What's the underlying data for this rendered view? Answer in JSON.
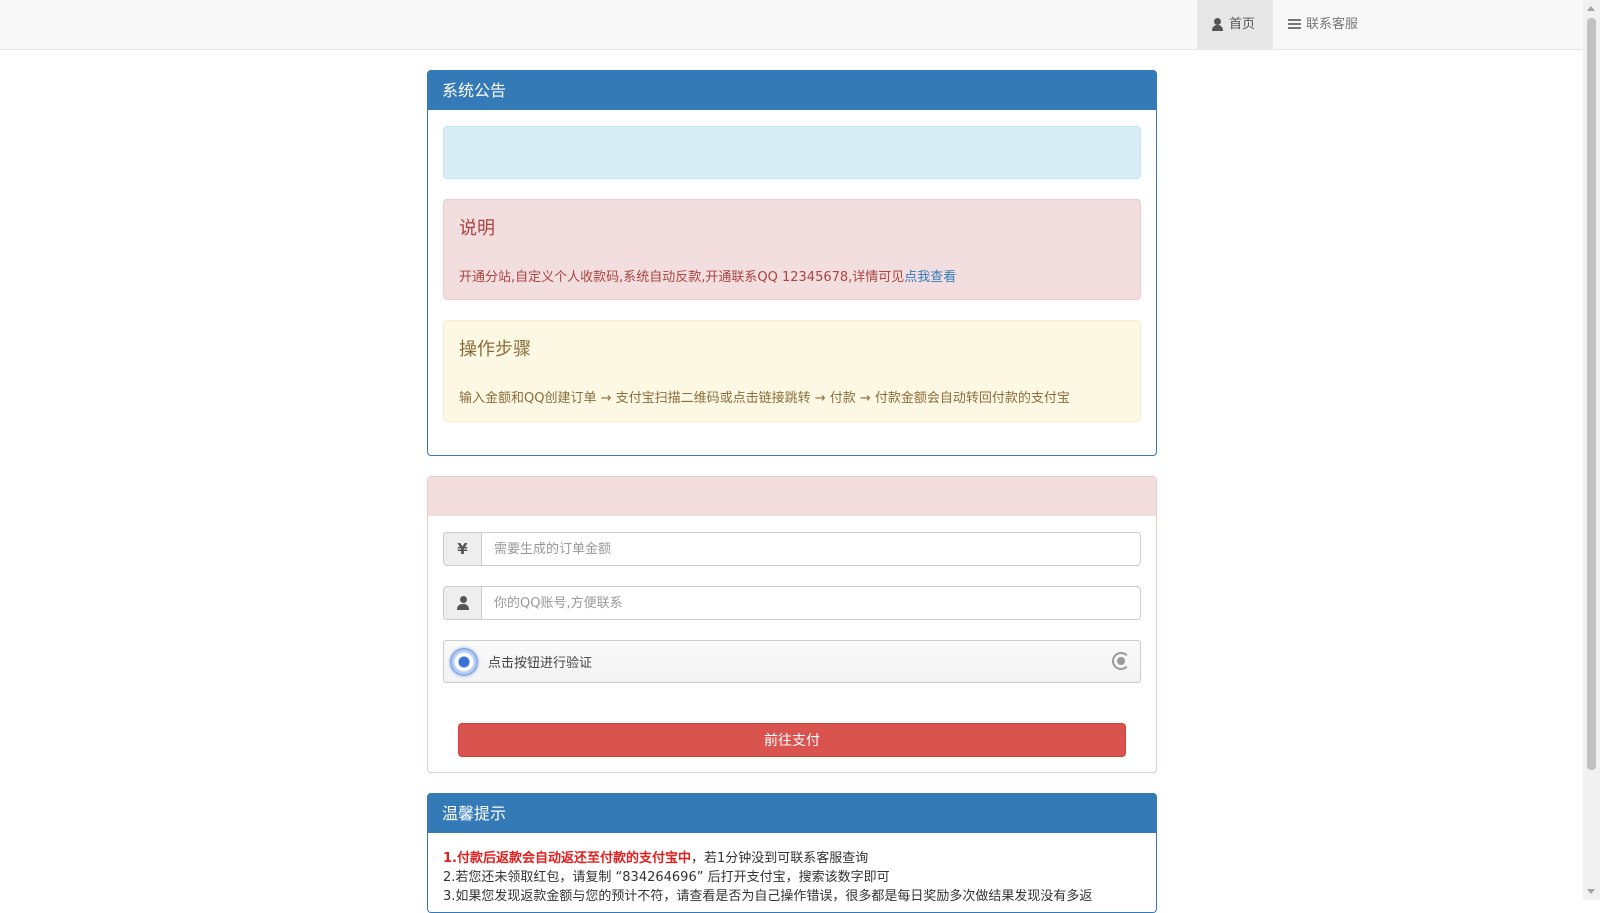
{
  "nav": {
    "home_label": "首页",
    "support_label": "联系客服"
  },
  "announcement": {
    "title": "系统公告",
    "info_text": "",
    "description": {
      "heading": "说明",
      "text": "开通分站,自定义个人收款码,系统自动反款,开通联系QQ 12345678,详情可见",
      "link_label": "点我查看"
    },
    "steps": {
      "heading": "操作步骤",
      "text": "输入金额和QQ创建订单 → 支付宝扫描二维码或点击链接跳转 → 付款 → 付款金额会自动转回付款的支付宝"
    }
  },
  "order_form": {
    "heading_text": "",
    "amount": {
      "icon": "yen-icon",
      "icon_glyph": "¥",
      "value": "",
      "placeholder": "需要生成的订单金额"
    },
    "qq": {
      "icon": "user-icon",
      "value": "",
      "placeholder": "你的QQ账号,方便联系"
    },
    "captcha": {
      "label": "点击按钮进行验证",
      "accent": "#3c72d6"
    },
    "pay_button_label": "前往支付"
  },
  "tips": {
    "title": "温馨提示",
    "line1_strong": "1.付款后返款会自动返还至付款的支付宝中",
    "line1_rest": "，若1分钟没到可联系客服查询",
    "line2": "2.若您还未领取红包，请复制 “834264696” 后打开支付宝，搜索该数字即可",
    "line3": "3.如果您发现返款金额与您的预计不符，请查看是否为自己操作错误，很多都是每日奖励多次做结果发现没有多返"
  },
  "colors": {
    "primary": "#337ab7",
    "danger": "#d9534f",
    "danger_bg": "#f2dede",
    "info_bg": "#d9edf7",
    "warning_bg": "#fcf8e3"
  }
}
